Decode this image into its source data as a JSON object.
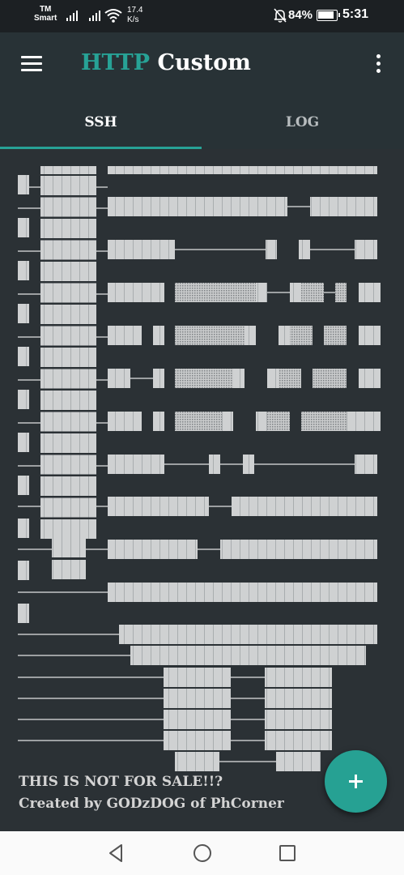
{
  "status_bar": {
    "carrier_line1": "TM",
    "carrier_line2": "Smart",
    "speed_value": "17.4",
    "speed_unit": "K/s",
    "battery": "84%",
    "time": "5:31",
    "icons": [
      "signal-icon",
      "signal-icon",
      "wifi-icon",
      "mute-bell-icon",
      "battery-charging-icon"
    ]
  },
  "app_bar": {
    "title_accent": "HTTP",
    "title_rest": "Custom",
    "menu_icon": "hamburger-icon",
    "overflow_icon": "more-vert-icon"
  },
  "tabs": [
    {
      "label": "SSH",
      "active": true
    },
    {
      "label": "LOG",
      "active": false
    }
  ],
  "content": {
    "footer_line1": "THIS IS NOT FOR SALE!!?",
    "footer_line2": "Created by GODzDOG of PhCorner"
  },
  "fab": {
    "icon": "plus-icon"
  },
  "nav_bar": {
    "icons": [
      "back-icon",
      "home-icon",
      "recents-icon"
    ]
  },
  "colors": {
    "accent": "#27a296",
    "app_bar": "#283236",
    "background": "#2b3135",
    "block": "#cdcfd0",
    "line": "#bfc3c4"
  }
}
